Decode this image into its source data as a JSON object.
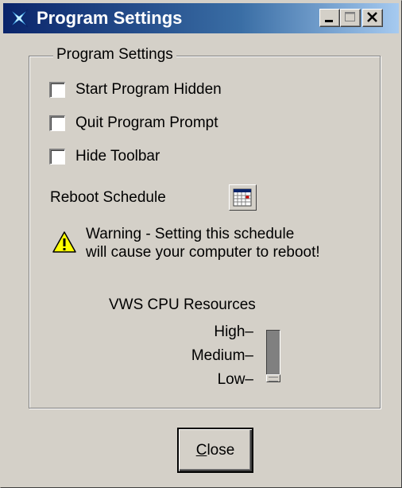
{
  "window": {
    "title": "Program Settings",
    "controls": {
      "minimize": "minimize",
      "maximize": "maximize",
      "close": "close"
    }
  },
  "group": {
    "legend": "Program Settings",
    "checkboxes": [
      {
        "label": "Start Program Hidden",
        "checked": false
      },
      {
        "label": "Quit Program Prompt",
        "checked": false
      },
      {
        "label": "Hide Toolbar",
        "checked": false
      }
    ],
    "reboot_label": "Reboot Schedule",
    "warning_line1": "Warning - Setting this schedule",
    "warning_line2": "will cause your computer to reboot!",
    "cpu_title": "VWS CPU Resources",
    "slider": {
      "labels": [
        "High",
        "Medium",
        "Low"
      ],
      "value": "Low"
    }
  },
  "close_button": {
    "mnemonic": "C",
    "rest": "lose"
  },
  "icons": {
    "app": "program-settings-app-icon",
    "calendar": "calendar-icon",
    "warning": "warning-triangle-icon"
  },
  "colors": {
    "face": "#d4d0c8",
    "title_start": "#0a246a",
    "title_end": "#a6caf0",
    "warning_fill": "#ffff00"
  }
}
